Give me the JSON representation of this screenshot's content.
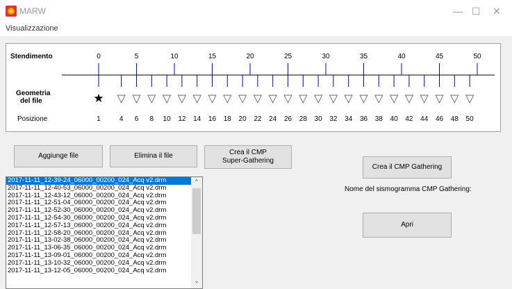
{
  "window": {
    "title": "MARW",
    "min_glyph": "—",
    "max_glyph": "☐",
    "close_glyph": "✕"
  },
  "menu": {
    "items": [
      "Visualizzazione"
    ]
  },
  "geometry": {
    "label_stendimento": "Stendimento",
    "label_geometria_1": "Geometria",
    "label_geometria_2": "del file",
    "label_posizione": "Posizione",
    "scale_ticks": [
      "0",
      "5",
      "10",
      "15",
      "20",
      "25",
      "30",
      "35",
      "40",
      "45",
      "50"
    ],
    "positions": [
      "1",
      "4",
      "6",
      "8",
      "10",
      "12",
      "14",
      "16",
      "18",
      "20",
      "22",
      "24",
      "26",
      "28",
      "30",
      "32",
      "34",
      "36",
      "38",
      "40",
      "42",
      "44",
      "46",
      "48",
      "50"
    ],
    "source_symbol": "★",
    "receiver_symbol": "▽",
    "colors": {
      "tick": "#0000cc",
      "baseline": "#000000",
      "receiver": "#808080"
    }
  },
  "buttons": {
    "add": "Aggiunge file",
    "delete": "Elimina il file",
    "super_line1": "Crea il CMP",
    "super_line2": "Super-Gathering",
    "create": "Crea il CMP Gathering",
    "open": "Apri"
  },
  "cmp_name_label": "Nome del sismogramma CMP Gathering:",
  "files": [
    "2017-11-11_12-39-24_06000_00200_024_Acq v2.drm",
    "2017-11-11_12-40-53_06000_00200_024_Acq v2.drm",
    "2017-11-11_12-43-12_06000_00200_024_Acq v2.drm",
    "2017-11-11_12-51-04_06000_00200_024_Acq v2.drm",
    "2017-11-11_12-52-30_06000_00200_024_Acq v2.drm",
    "2017-11-11_12-54-30_06000_00200_024_Acq v2.drm",
    "2017-11-11_12-57-13_06000_00200_024_Acq v2.drm",
    "2017-11-11_12-58-20_06000_00200_024_Acq v2.drm",
    "2017-11-11_13-02-38_06000_00200_024_Acq v2.drm",
    "2017-11-11_13-06-35_06000_00200_024_Acq v2.drm",
    "2017-11-11_13-09-01_06000_00200_024_Acq v2.drm",
    "2017-11-11_13-10-32_06000_00200_024_Acq v2.drm",
    "2017-11-11_13-12-05_06000_00200_024_Acq v2.drm"
  ],
  "selected_file_index": 0,
  "scroll": {
    "up": "⌃",
    "down": "⌄"
  }
}
